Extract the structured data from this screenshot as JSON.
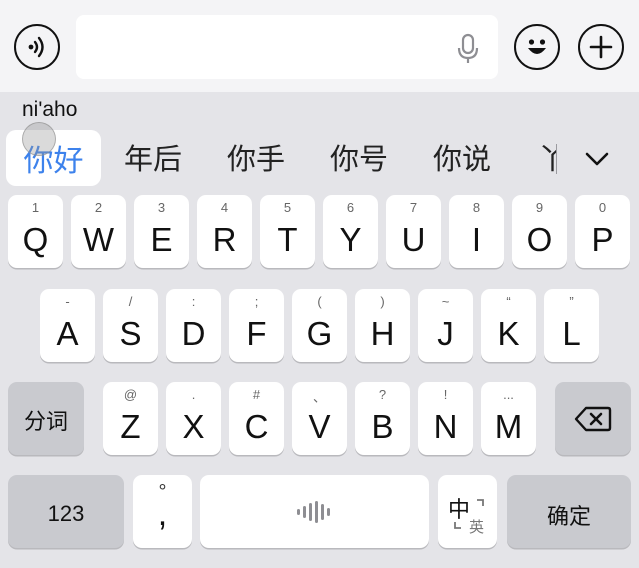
{
  "topbar": {
    "voice_icon": "voice-wave-icon",
    "input_value": "",
    "mic_icon": "microphone-icon",
    "emoji_icon": "emoji-icon",
    "plus_icon": "plus-icon"
  },
  "composition": {
    "pinyin": "ni'aho"
  },
  "candidates": {
    "first": "你好",
    "items": [
      "年后",
      "你手",
      "你号",
      "你说"
    ],
    "partial": "丫",
    "expand_icon": "chevron-down-icon"
  },
  "rows": {
    "row1": [
      {
        "sub": "1",
        "main": "Q"
      },
      {
        "sub": "2",
        "main": "W"
      },
      {
        "sub": "3",
        "main": "E"
      },
      {
        "sub": "4",
        "main": "R"
      },
      {
        "sub": "5",
        "main": "T"
      },
      {
        "sub": "6",
        "main": "Y"
      },
      {
        "sub": "7",
        "main": "U"
      },
      {
        "sub": "8",
        "main": "I"
      },
      {
        "sub": "9",
        "main": "O"
      },
      {
        "sub": "0",
        "main": "P"
      }
    ],
    "row2": [
      {
        "sub": "-",
        "main": "A"
      },
      {
        "sub": "/",
        "main": "S"
      },
      {
        "sub": ":",
        "main": "D"
      },
      {
        "sub": ";",
        "main": "F"
      },
      {
        "sub": "(",
        "main": "G"
      },
      {
        "sub": ")",
        "main": "H"
      },
      {
        "sub": "~",
        "main": "J"
      },
      {
        "sub": "“",
        "main": "K"
      },
      {
        "sub": "”",
        "main": "L"
      }
    ],
    "row3": [
      {
        "sub": "@",
        "main": "Z"
      },
      {
        "sub": ".",
        "main": "X"
      },
      {
        "sub": "#",
        "main": "C"
      },
      {
        "sub": "、",
        "main": "V"
      },
      {
        "sub": "?",
        "main": "B"
      },
      {
        "sub": "!",
        "main": "N"
      },
      {
        "sub": "...",
        "main": "M"
      }
    ]
  },
  "keys": {
    "segment": "分词",
    "numbers": "123",
    "punct_top": "°",
    "punct_main": ",",
    "lang_zh": "中",
    "lang_en": "英",
    "confirm": "确定",
    "backspace_icon": "backspace-icon",
    "space_icon": "voice-input-icon"
  }
}
